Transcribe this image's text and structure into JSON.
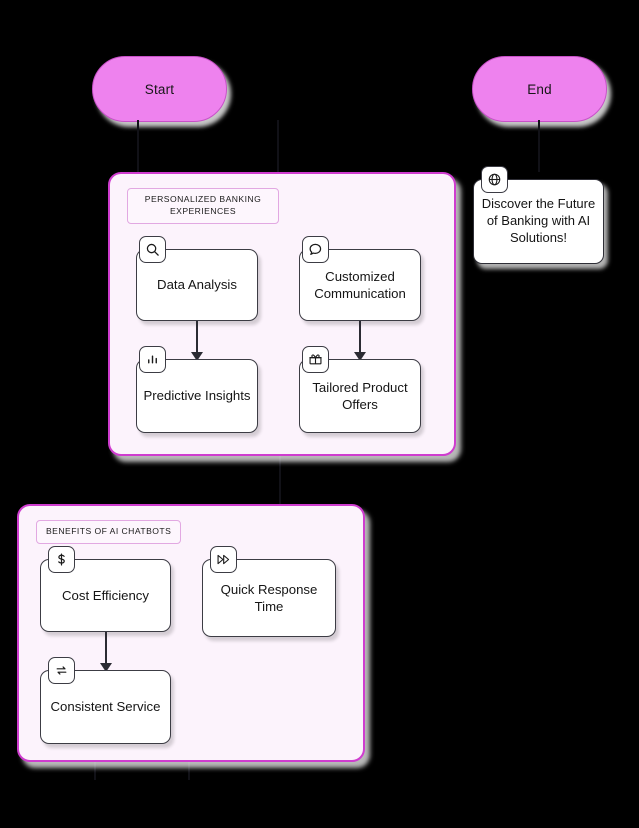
{
  "diagram": {
    "background": "#000000",
    "accent": "#cf3ccf",
    "terminal_fill": "#ee82ee",
    "node_fill": "#ffffff",
    "group_fill": "#fcf3fc"
  },
  "terminals": {
    "start": {
      "label": "Start"
    },
    "end": {
      "label": "End"
    }
  },
  "groups": [
    {
      "label": "PERSONALIZED BANKING EXPERIENCES",
      "nodes": [
        {
          "label": "Data Analysis",
          "icon": "search-icon"
        },
        {
          "label": "Customized Communication",
          "icon": "chat-bubble-icon"
        },
        {
          "label": "Predictive Insights",
          "icon": "bar-chart-icon"
        },
        {
          "label": "Tailored Product Offers",
          "icon": "gift-icon"
        }
      ]
    },
    {
      "label": "BENEFITS OF AI CHATBOTS",
      "nodes": [
        {
          "label": "Cost Efficiency",
          "icon": "dollar-icon"
        },
        {
          "label": "Quick Response Time",
          "icon": "fast-forward-icon"
        },
        {
          "label": "Consistent Service",
          "icon": "repeat-icon"
        }
      ]
    }
  ],
  "note": {
    "label": "Discover the Future of Banking with AI Solutions!",
    "icon": "globe-icon"
  }
}
